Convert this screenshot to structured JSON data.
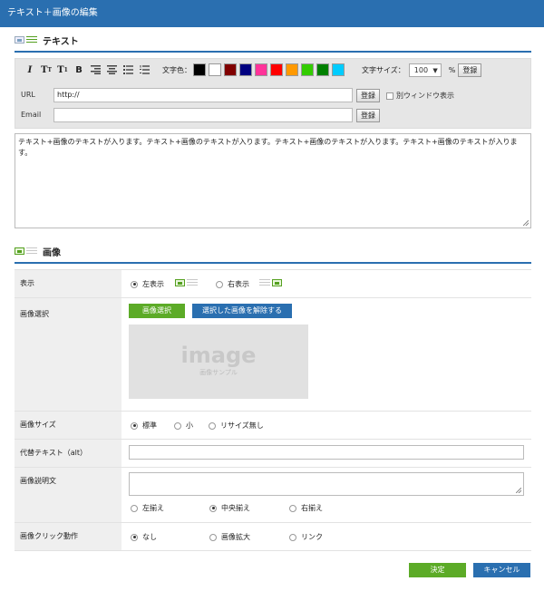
{
  "window": {
    "title": "テキスト＋画像の編集"
  },
  "text_section": {
    "heading": "テキスト"
  },
  "toolbar": {
    "format_buttons": [
      {
        "glyph": "I"
      },
      {
        "glyph": "T"
      },
      {
        "glyph": "T"
      },
      {
        "glyph": "B"
      }
    ],
    "color_label": "文字色：",
    "colors": [
      "#000000",
      "#ffffff",
      "#800000",
      "#000080",
      "#ff3399",
      "#ff0000",
      "#ff9900",
      "#33cc00",
      "#008000",
      "#00ccff"
    ],
    "size_label": "文字サイズ：",
    "size_value": "100",
    "size_unit": "%",
    "register_label": "登録",
    "url_label": "URL",
    "url_value": "http://",
    "url_register": "登録",
    "new_window_label": "別ウィンドウ表示",
    "email_label": "Email",
    "email_value": "",
    "email_register": "登録"
  },
  "body_text": "テキスト+画像のテキストが入ります。テキスト+画像のテキストが入ります。テキスト+画像のテキストが入ります。テキスト+画像のテキストが入ります。",
  "image_section": {
    "heading": "画像"
  },
  "display": {
    "label": "表示",
    "options": [
      {
        "label": "左表示",
        "selected": true
      },
      {
        "label": "右表示",
        "selected": false
      }
    ]
  },
  "image_select": {
    "label": "画像選択",
    "select_button": "画像選択",
    "clear_button": "選択した画像を解除する",
    "placeholder_big": "image",
    "placeholder_small": "画像サンプル"
  },
  "image_size": {
    "label": "画像サイズ",
    "options": [
      {
        "label": "標準",
        "selected": true
      },
      {
        "label": "小",
        "selected": false
      },
      {
        "label": "リサイズ無し",
        "selected": false
      }
    ]
  },
  "alt_text": {
    "label": "代替テキスト（alt）",
    "value": ""
  },
  "caption": {
    "label": "画像説明文",
    "value": "",
    "align_options": [
      {
        "label": "左揃え",
        "selected": false
      },
      {
        "label": "中央揃え",
        "selected": true
      },
      {
        "label": "右揃え",
        "selected": false
      }
    ]
  },
  "click_action": {
    "label": "画像クリック動作",
    "options": [
      {
        "label": "なし",
        "selected": true
      },
      {
        "label": "画像拡大",
        "selected": false
      },
      {
        "label": "リンク",
        "selected": false
      }
    ]
  },
  "footer": {
    "ok_label": "決定",
    "cancel_label": "キャンセル"
  }
}
